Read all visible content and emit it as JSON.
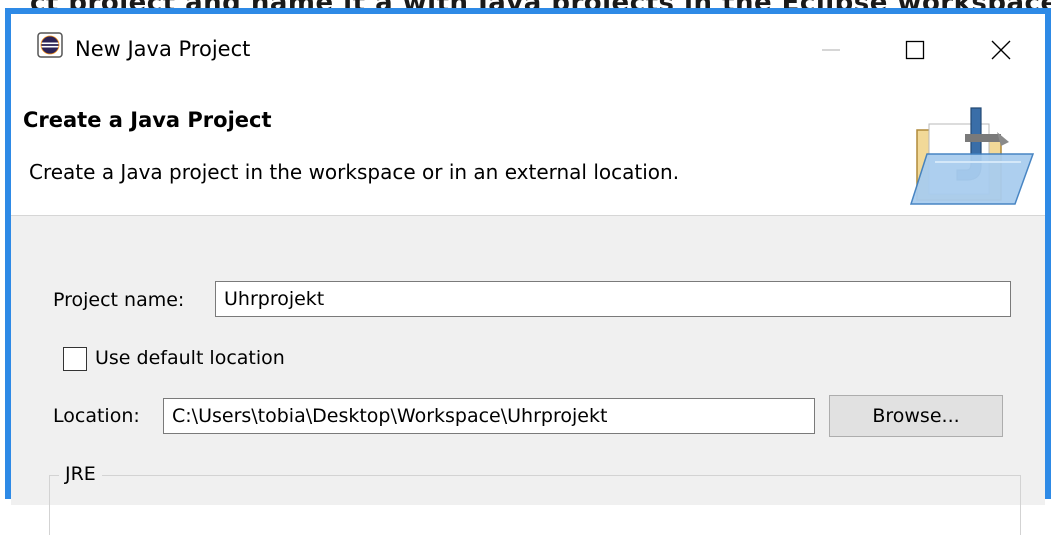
{
  "top_strip_text": "ct project and name it a with Java projects in the Eclipse workspace",
  "window": {
    "title": "New Java Project",
    "app_icon": "eclipse-icon",
    "controls": {
      "minimize_icon": "minimize-icon",
      "maximize_icon": "maximize-icon",
      "close_icon": "close-icon"
    }
  },
  "header": {
    "title": "Create a Java Project",
    "description": "Create a Java project in the workspace or in an external location.",
    "banner_icon": "java-folder-icon"
  },
  "form": {
    "project_name_label": "Project name:",
    "project_name_value": "Uhrprojekt",
    "use_default_location_label": "Use default location",
    "use_default_location_checked": false,
    "location_label": "Location:",
    "location_value": "C:\\Users\\tobia\\Desktop\\Workspace\\Uhrprojekt",
    "browse_label": "Browse...",
    "jre_group_label": "JRE"
  },
  "colors": {
    "window_border": "#2e8ae6",
    "content_background": "#f0f0f0",
    "button_background": "#e1e1e1"
  }
}
